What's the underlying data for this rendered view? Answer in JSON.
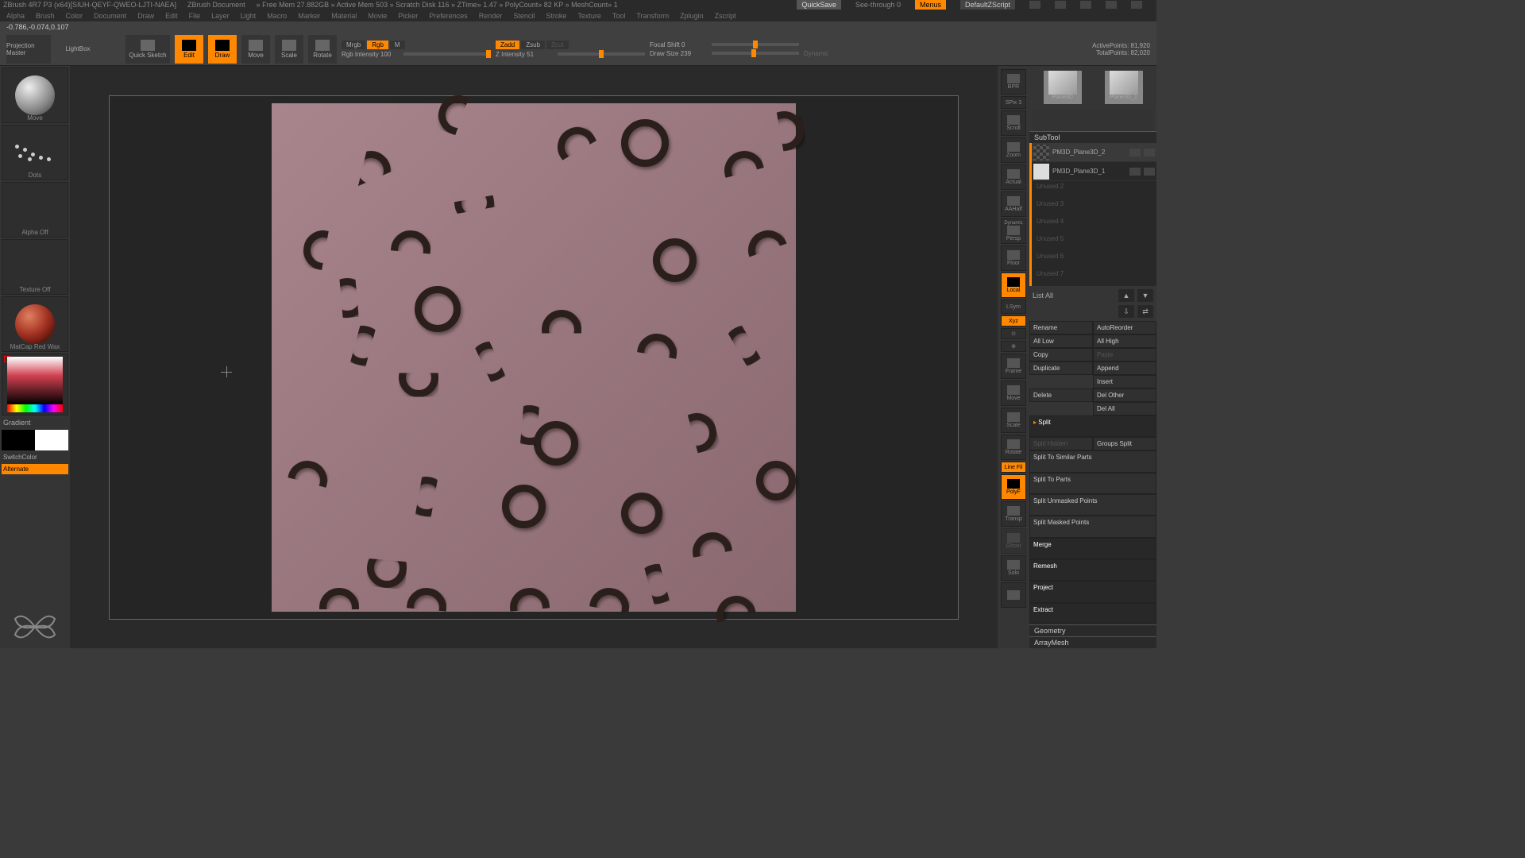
{
  "titlebar": {
    "app": "ZBrush 4R7 P3 (x64)[SIUH-QEYF-QWEO-LJTI-NAEA]",
    "doc": "ZBrush Document",
    "mem": "» Free Mem 27.882GB » Active Mem 503 » Scratch Disk 116 » ZTime» 1.47 » PolyCount» 82 KP » MeshCount» 1",
    "quicksave": "QuickSave",
    "seethrough": "See-through  0",
    "menus": "Menus",
    "defaultscript": "DefaultZScript"
  },
  "menubar": [
    "Alpha",
    "Brush",
    "Color",
    "Document",
    "Draw",
    "Edit",
    "File",
    "Layer",
    "Light",
    "Macro",
    "Marker",
    "Material",
    "Movie",
    "Picker",
    "Preferences",
    "Render",
    "Stencil",
    "Stroke",
    "Texture",
    "Tool",
    "Transform",
    "Zplugin",
    "Zscript"
  ],
  "statusline": "-0.786,-0.074,0.107",
  "toolbar": {
    "projection": "Projection Master",
    "lightbox": "LightBox",
    "quicksketch": "Quick Sketch",
    "edit": "Edit",
    "draw": "Draw",
    "move": "Move",
    "scale": "Scale",
    "rotate": "Rotate",
    "mrgb": "Mrgb",
    "rgb": "Rgb",
    "m": "M",
    "rgb_intensity_label": "Rgb Intensity 100",
    "zadd": "Zadd",
    "zsub": "Zsub",
    "zcut": "Zcut",
    "z_intensity_label": "Z Intensity 51",
    "focal_shift": "Focal Shift 0",
    "draw_size": "Draw Size 239",
    "dynamic": "Dynamic",
    "active_points": "ActivePoints: 81,920",
    "total_points": "TotalPoints: 82,020"
  },
  "left": {
    "move": "Move",
    "dots": "Dots",
    "alpha": "Alpha Off",
    "texture": "Texture Off",
    "material": "MatCap Red Wax",
    "gradient": "Gradient",
    "switchcolor": "SwitchColor",
    "alternate": "Alternate"
  },
  "right_tools": {
    "bpr": "BPR",
    "spix": "SPix 3",
    "scroll": "Scroll",
    "zoom": "Zoom",
    "actual": "Actual",
    "aahalf": "AAHalf",
    "dynamic": "Dynamic",
    "persp": "Persp",
    "floor": "Floor",
    "local": "Local",
    "lsym": "LSym",
    "xyz": "Xyz",
    "frame": "Frame",
    "move": "Move",
    "scale": "Scale",
    "rotate": "Rotate",
    "linefill": "Line Fil",
    "polyf": "PolyF",
    "transp": "Transp",
    "ghost": "Ghost",
    "solo": "Solo"
  },
  "right_panel": {
    "thumb1": "Plane3D",
    "thumb2": "Plane3D_1",
    "subtool_hdr": "SubTool",
    "st_items": [
      "PM3D_Plane3D_2",
      "PM3D_Plane3D_1"
    ],
    "slots": [
      "Unused 2",
      "Unused 3",
      "Unused 4",
      "Unused 5",
      "Unused 6",
      "Unused 7"
    ],
    "list_all": "List All",
    "rename": "Rename",
    "autoreorder": "AutoReorder",
    "all_low": "All Low",
    "all_high": "All High",
    "copy": "Copy",
    "paste": "Paste",
    "duplicate": "Duplicate",
    "append": "Append",
    "insert": "Insert",
    "delete": "Delete",
    "del_other": "Del Other",
    "del_all": "Del All",
    "split": "Split",
    "split_hidden": "Split Hidden",
    "groups_split": "Groups Split",
    "split_similar": "Split To Similar Parts",
    "split_parts": "Split To Parts",
    "split_unmasked": "Split Unmasked Points",
    "split_masked": "Split Masked Points",
    "merge": "Merge",
    "remesh": "Remesh",
    "project": "Project",
    "extract": "Extract",
    "geometry": "Geometry",
    "arraymesh": "ArrayMesh"
  }
}
